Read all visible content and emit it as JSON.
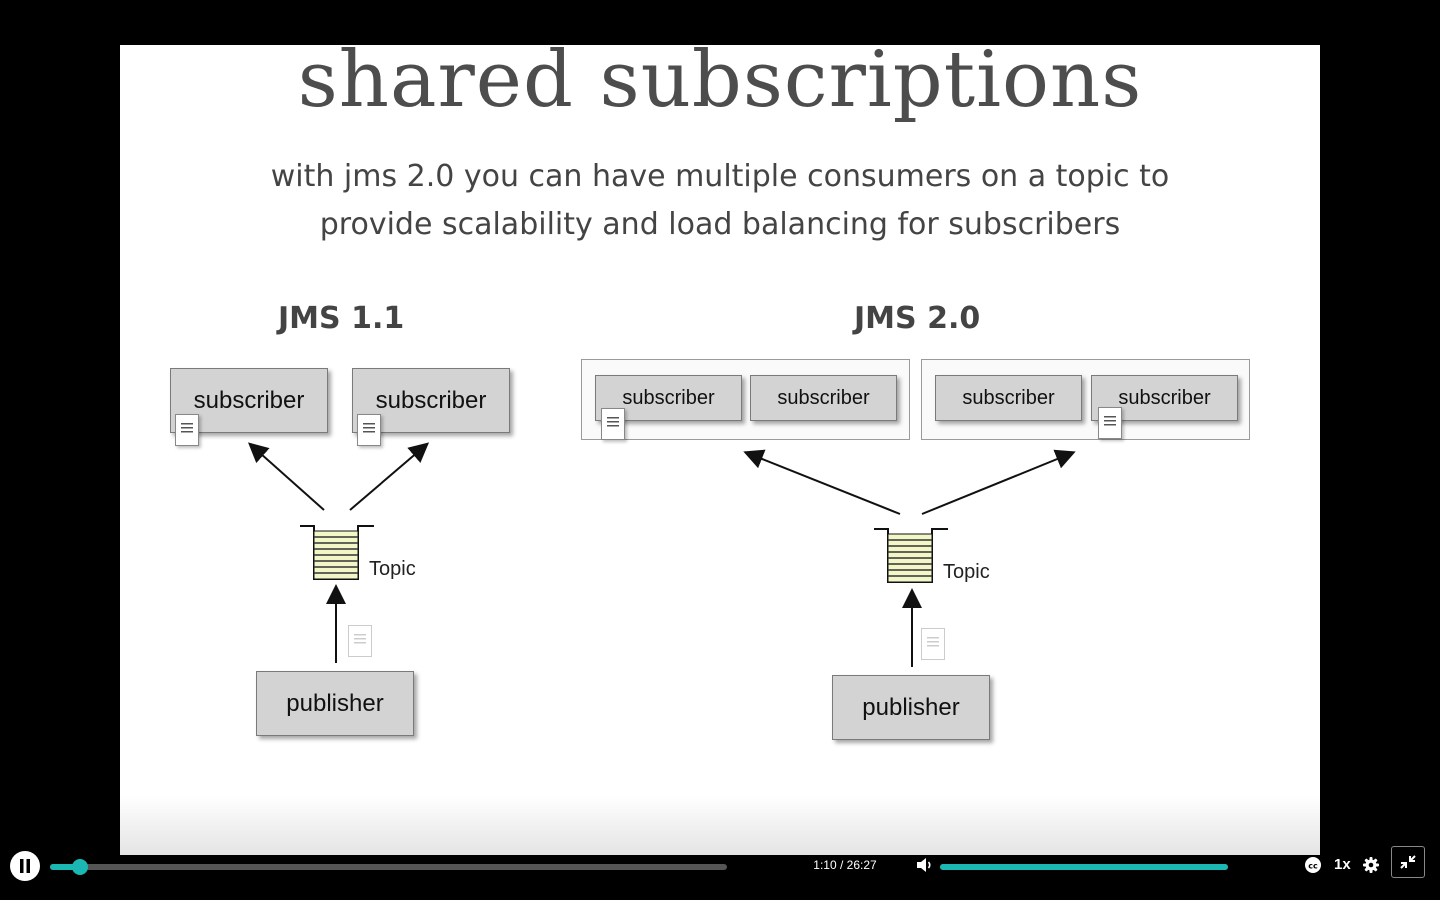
{
  "slide": {
    "title": "shared subscriptions",
    "subtitle_line1": "with jms 2.0 you can have multiple consumers on a topic to",
    "subtitle_line2": "provide scalability and load balancing for subscribers"
  },
  "left_diagram": {
    "heading": "JMS 1.1",
    "subscriber_1": "subscriber",
    "subscriber_2": "subscriber",
    "topic": "Topic",
    "publisher": "publisher"
  },
  "right_diagram": {
    "heading": "JMS 2.0",
    "group_1": [
      "subscriber",
      "subscriber"
    ],
    "group_2": [
      "subscriber",
      "subscriber"
    ],
    "topic": "Topic",
    "publisher": "publisher"
  },
  "player": {
    "time": "1:10 / 26:27",
    "progress_fraction": 0.044,
    "volume_fraction": 1.0,
    "speed": "1x",
    "accent": "#1ab7b3",
    "icons": [
      "pause-icon",
      "volume-icon",
      "captions-icon",
      "settings-icon",
      "exit-fullscreen-icon"
    ]
  }
}
